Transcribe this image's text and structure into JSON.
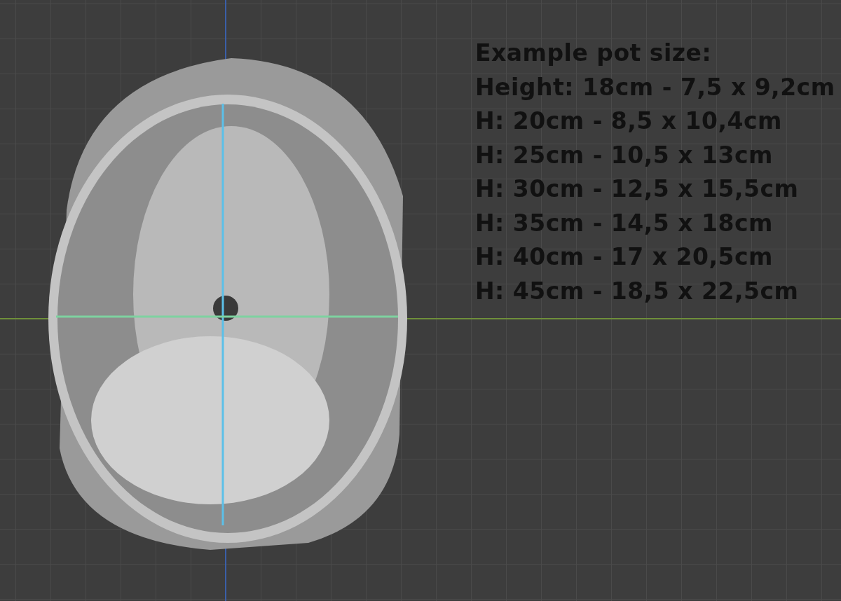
{
  "viewport": {
    "annotation_lines": [
      "Example pot size:",
      "Height: 18cm - 7,5 x 9,2cm",
      "H: 20cm - 8,5 x 10,4cm",
      "H: 25cm - 10,5 x 13cm",
      "H: 30cm - 12,5 x 15,5cm",
      "H: 35cm - 14,5 x 18cm",
      "H: 40cm - 17 x 20,5cm",
      "H: 45cm - 18,5 x 22,5cm"
    ]
  }
}
